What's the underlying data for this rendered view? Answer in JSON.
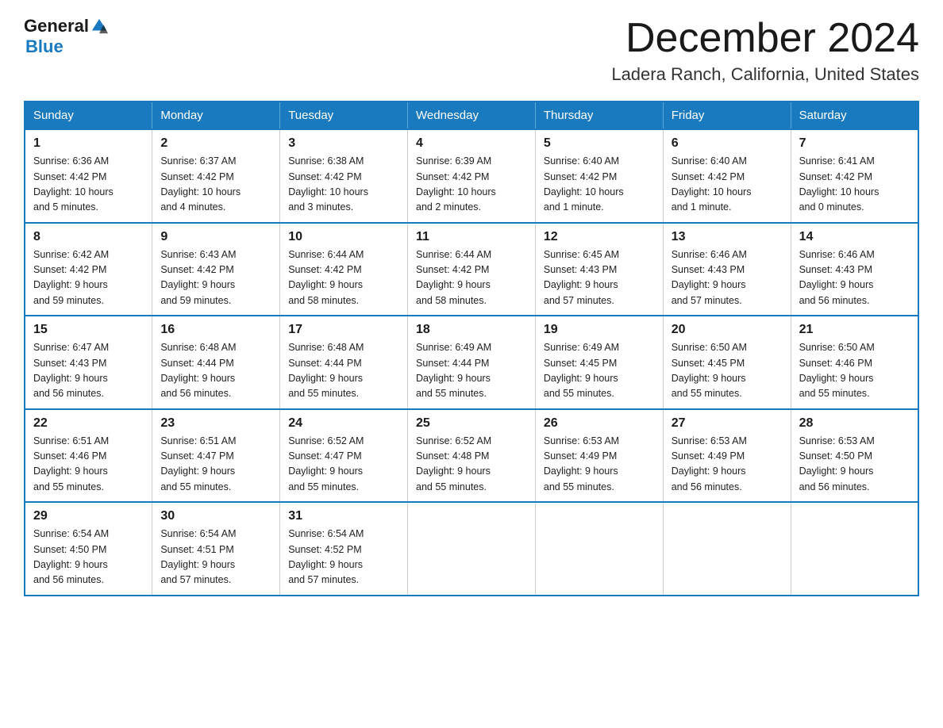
{
  "header": {
    "logo_general": "General",
    "logo_blue": "Blue",
    "title": "December 2024",
    "subtitle": "Ladera Ranch, California, United States"
  },
  "days_of_week": [
    "Sunday",
    "Monday",
    "Tuesday",
    "Wednesday",
    "Thursday",
    "Friday",
    "Saturday"
  ],
  "weeks": [
    [
      {
        "day": "1",
        "sunrise": "6:36 AM",
        "sunset": "4:42 PM",
        "daylight": "10 hours and 5 minutes."
      },
      {
        "day": "2",
        "sunrise": "6:37 AM",
        "sunset": "4:42 PM",
        "daylight": "10 hours and 4 minutes."
      },
      {
        "day": "3",
        "sunrise": "6:38 AM",
        "sunset": "4:42 PM",
        "daylight": "10 hours and 3 minutes."
      },
      {
        "day": "4",
        "sunrise": "6:39 AM",
        "sunset": "4:42 PM",
        "daylight": "10 hours and 2 minutes."
      },
      {
        "day": "5",
        "sunrise": "6:40 AM",
        "sunset": "4:42 PM",
        "daylight": "10 hours and 1 minute."
      },
      {
        "day": "6",
        "sunrise": "6:40 AM",
        "sunset": "4:42 PM",
        "daylight": "10 hours and 1 minute."
      },
      {
        "day": "7",
        "sunrise": "6:41 AM",
        "sunset": "4:42 PM",
        "daylight": "10 hours and 0 minutes."
      }
    ],
    [
      {
        "day": "8",
        "sunrise": "6:42 AM",
        "sunset": "4:42 PM",
        "daylight": "9 hours and 59 minutes."
      },
      {
        "day": "9",
        "sunrise": "6:43 AM",
        "sunset": "4:42 PM",
        "daylight": "9 hours and 59 minutes."
      },
      {
        "day": "10",
        "sunrise": "6:44 AM",
        "sunset": "4:42 PM",
        "daylight": "9 hours and 58 minutes."
      },
      {
        "day": "11",
        "sunrise": "6:44 AM",
        "sunset": "4:42 PM",
        "daylight": "9 hours and 58 minutes."
      },
      {
        "day": "12",
        "sunrise": "6:45 AM",
        "sunset": "4:43 PM",
        "daylight": "9 hours and 57 minutes."
      },
      {
        "day": "13",
        "sunrise": "6:46 AM",
        "sunset": "4:43 PM",
        "daylight": "9 hours and 57 minutes."
      },
      {
        "day": "14",
        "sunrise": "6:46 AM",
        "sunset": "4:43 PM",
        "daylight": "9 hours and 56 minutes."
      }
    ],
    [
      {
        "day": "15",
        "sunrise": "6:47 AM",
        "sunset": "4:43 PM",
        "daylight": "9 hours and 56 minutes."
      },
      {
        "day": "16",
        "sunrise": "6:48 AM",
        "sunset": "4:44 PM",
        "daylight": "9 hours and 56 minutes."
      },
      {
        "day": "17",
        "sunrise": "6:48 AM",
        "sunset": "4:44 PM",
        "daylight": "9 hours and 55 minutes."
      },
      {
        "day": "18",
        "sunrise": "6:49 AM",
        "sunset": "4:44 PM",
        "daylight": "9 hours and 55 minutes."
      },
      {
        "day": "19",
        "sunrise": "6:49 AM",
        "sunset": "4:45 PM",
        "daylight": "9 hours and 55 minutes."
      },
      {
        "day": "20",
        "sunrise": "6:50 AM",
        "sunset": "4:45 PM",
        "daylight": "9 hours and 55 minutes."
      },
      {
        "day": "21",
        "sunrise": "6:50 AM",
        "sunset": "4:46 PM",
        "daylight": "9 hours and 55 minutes."
      }
    ],
    [
      {
        "day": "22",
        "sunrise": "6:51 AM",
        "sunset": "4:46 PM",
        "daylight": "9 hours and 55 minutes."
      },
      {
        "day": "23",
        "sunrise": "6:51 AM",
        "sunset": "4:47 PM",
        "daylight": "9 hours and 55 minutes."
      },
      {
        "day": "24",
        "sunrise": "6:52 AM",
        "sunset": "4:47 PM",
        "daylight": "9 hours and 55 minutes."
      },
      {
        "day": "25",
        "sunrise": "6:52 AM",
        "sunset": "4:48 PM",
        "daylight": "9 hours and 55 minutes."
      },
      {
        "day": "26",
        "sunrise": "6:53 AM",
        "sunset": "4:49 PM",
        "daylight": "9 hours and 55 minutes."
      },
      {
        "day": "27",
        "sunrise": "6:53 AM",
        "sunset": "4:49 PM",
        "daylight": "9 hours and 56 minutes."
      },
      {
        "day": "28",
        "sunrise": "6:53 AM",
        "sunset": "4:50 PM",
        "daylight": "9 hours and 56 minutes."
      }
    ],
    [
      {
        "day": "29",
        "sunrise": "6:54 AM",
        "sunset": "4:50 PM",
        "daylight": "9 hours and 56 minutes."
      },
      {
        "day": "30",
        "sunrise": "6:54 AM",
        "sunset": "4:51 PM",
        "daylight": "9 hours and 57 minutes."
      },
      {
        "day": "31",
        "sunrise": "6:54 AM",
        "sunset": "4:52 PM",
        "daylight": "9 hours and 57 minutes."
      },
      null,
      null,
      null,
      null
    ]
  ],
  "labels": {
    "sunrise": "Sunrise:",
    "sunset": "Sunset:",
    "daylight": "Daylight:"
  }
}
